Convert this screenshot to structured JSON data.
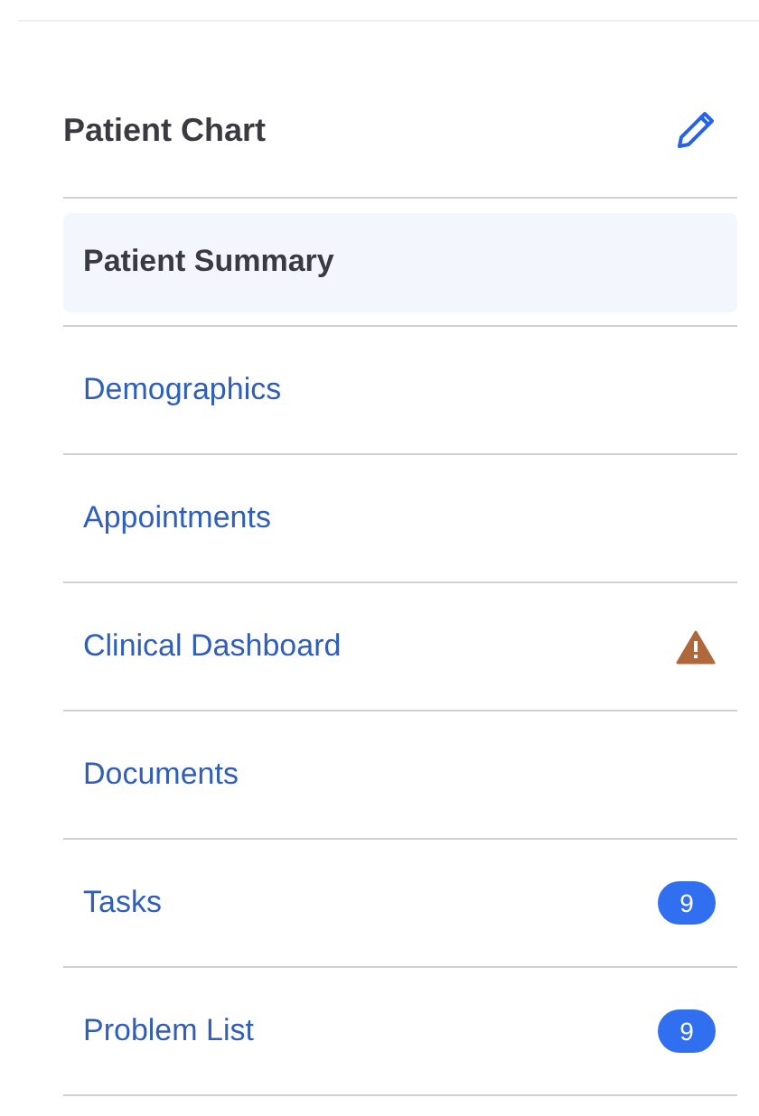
{
  "header": {
    "title": "Patient Chart"
  },
  "items": [
    {
      "label": "Patient Summary",
      "selected": true,
      "warning": false
    },
    {
      "label": "Demographics",
      "selected": false,
      "warning": false
    },
    {
      "label": "Appointments",
      "selected": false,
      "warning": false
    },
    {
      "label": "Clinical Dashboard",
      "selected": false,
      "warning": true
    },
    {
      "label": "Documents",
      "selected": false,
      "warning": false
    },
    {
      "label": "Tasks",
      "selected": false,
      "warning": false,
      "count": "9"
    },
    {
      "label": "Problem List",
      "selected": false,
      "warning": false,
      "count": "9"
    }
  ]
}
